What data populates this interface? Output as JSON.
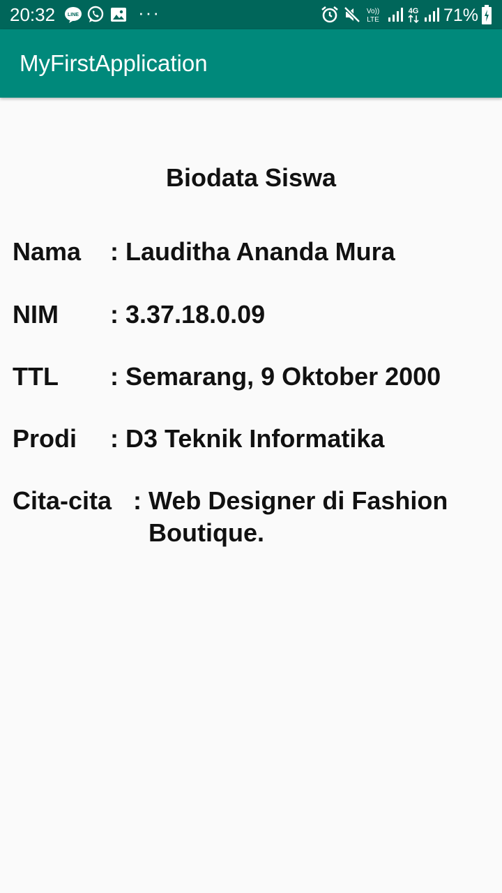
{
  "status_bar": {
    "time": "20:32",
    "notification_icons": [
      "line-icon",
      "whatsapp-icon",
      "image-icon"
    ],
    "more": "···",
    "system_icons": [
      "alarm-icon",
      "mute-icon",
      "volte-icon",
      "signal-icon",
      "4g-icon",
      "signal-icon",
      "battery-icon"
    ],
    "volte_label": "Vo)) LTE",
    "network_label": "4G",
    "battery": "71%",
    "colors": {
      "background": "#00665a",
      "foreground": "#ffffff"
    }
  },
  "app_bar": {
    "title": "MyFirstApplication",
    "color": "#00897b"
  },
  "main": {
    "heading": "Biodata Siswa",
    "rows": [
      {
        "label": "Nama",
        "value": ": Lauditha Ananda Mura"
      },
      {
        "label": "NIM",
        "value": ": 3.37.18.0.09"
      },
      {
        "label": "TTL",
        "value": ": Semarang, 9 Oktober 2000"
      },
      {
        "label": "Prodi",
        "value": ": D3 Teknik Informatika"
      },
      {
        "label": "Cita-cita",
        "value": ": Web Designer di Fashion",
        "value_continuation": "Boutique."
      }
    ]
  }
}
